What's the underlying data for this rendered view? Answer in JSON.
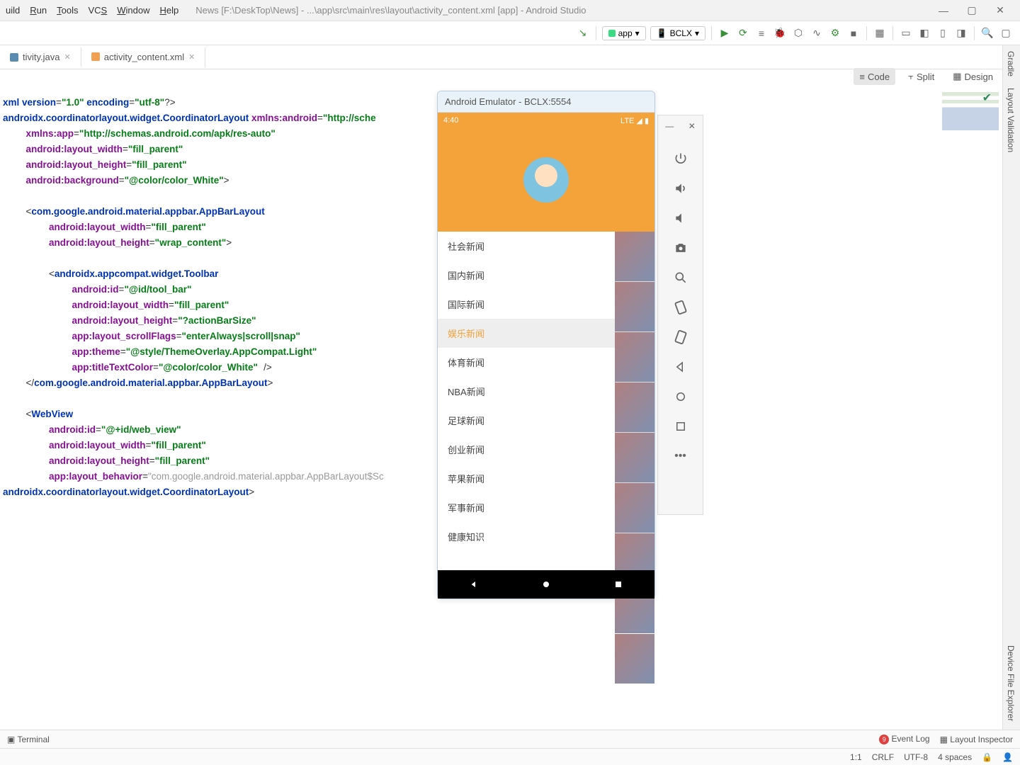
{
  "menu": {
    "items": [
      "uild",
      "Run",
      "Tools",
      "VCS",
      "Window",
      "Help"
    ],
    "title": "News [F:\\DeskTop\\News] - ...\\app\\src\\main\\res\\layout\\activity_content.xml [app] - Android Studio"
  },
  "toolbar": {
    "config": "app",
    "device": "BCLX"
  },
  "tabs": [
    {
      "name": "tivity.java",
      "active": false
    },
    {
      "name": "activity_content.xml",
      "active": true
    }
  ],
  "viewmodes": {
    "code": "Code",
    "split": "Split",
    "design": "Design"
  },
  "right": {
    "gradle": "Gradle",
    "layoutval": "Layout Validation",
    "devexp": "Device File Explorer"
  },
  "status": {
    "terminal": "Terminal",
    "eventlog": "Event Log",
    "layoutinsp": "Layout Inspector",
    "pos": "1:1",
    "crlf": "CRLF",
    "enc": "UTF-8",
    "indent": "4 spaces"
  },
  "emu": {
    "title": "Android Emulator - BCLX:5554",
    "time": "4:40",
    "net": "LTE",
    "drawer": [
      "社会新闻",
      "国内新闻",
      "国际新闻",
      "娱乐新闻",
      "体育新闻",
      "NBA新闻",
      "足球新闻",
      "创业新闻",
      "苹果新闻",
      "军事新闻",
      "健康知识"
    ],
    "selected": 3
  },
  "code": {
    "l1a": "xml version",
    "l1b": "\"1.0\"",
    "l1c": " encoding",
    "l1d": "\"utf-8\"",
    "l2": "androidx.coordinatorlayout.widget.CoordinatorLayout",
    "l2b": " xmlns:android",
    "l2c": "\"http://sche",
    "l3a": "xmlns:app",
    "l3b": "\"http://schemas.android.com/apk/res-auto\"",
    "l4a": "android:layout_width",
    "l4b": "\"fill_parent\"",
    "l5a": "android:layout_height",
    "l5b": "\"fill_parent\"",
    "l6a": "android:background",
    "l6b": "\"@color/color_White\"",
    "l7": "com.google.android.material.appbar.AppBarLayout",
    "l8a": "android:layout_width",
    "l8b": "\"fill_parent\"",
    "l9a": "android:layout_height",
    "l9b": "\"wrap_content\"",
    "l10": "androidx.appcompat.widget.Toolbar",
    "l11a": "android:id",
    "l11b": "\"@id/tool_bar\"",
    "l12a": "android:layout_width",
    "l12b": "\"fill_parent\"",
    "l13a": "android:layout_height",
    "l13b": "\"?actionBarSize\"",
    "l14a": "app:layout_scrollFlags",
    "l14b": "\"enterAlways|scroll|snap\"",
    "l15a": "app:theme",
    "l15b": "\"@style/ThemeOverlay.AppCompat.Light\"",
    "l16a": "app:titleTextColor",
    "l16b": "\"@color/color_White\"",
    "l17": "com.google.android.material.appbar.AppBarLayout",
    "l18": "WebView",
    "l19a": "android:id",
    "l19b": "\"@+id/web_view\"",
    "l20a": "android:layout_width",
    "l20b": "\"fill_parent\"",
    "l21a": "android:layout_height",
    "l21b": "\"fill_parent\"",
    "l22a": "app:layout_behavior",
    "l22b": "\"com.google.android.material.appbar.AppBarLayout$Sc",
    "l23": "androidx.coordinatorlayout.widget.CoordinatorLayout"
  }
}
